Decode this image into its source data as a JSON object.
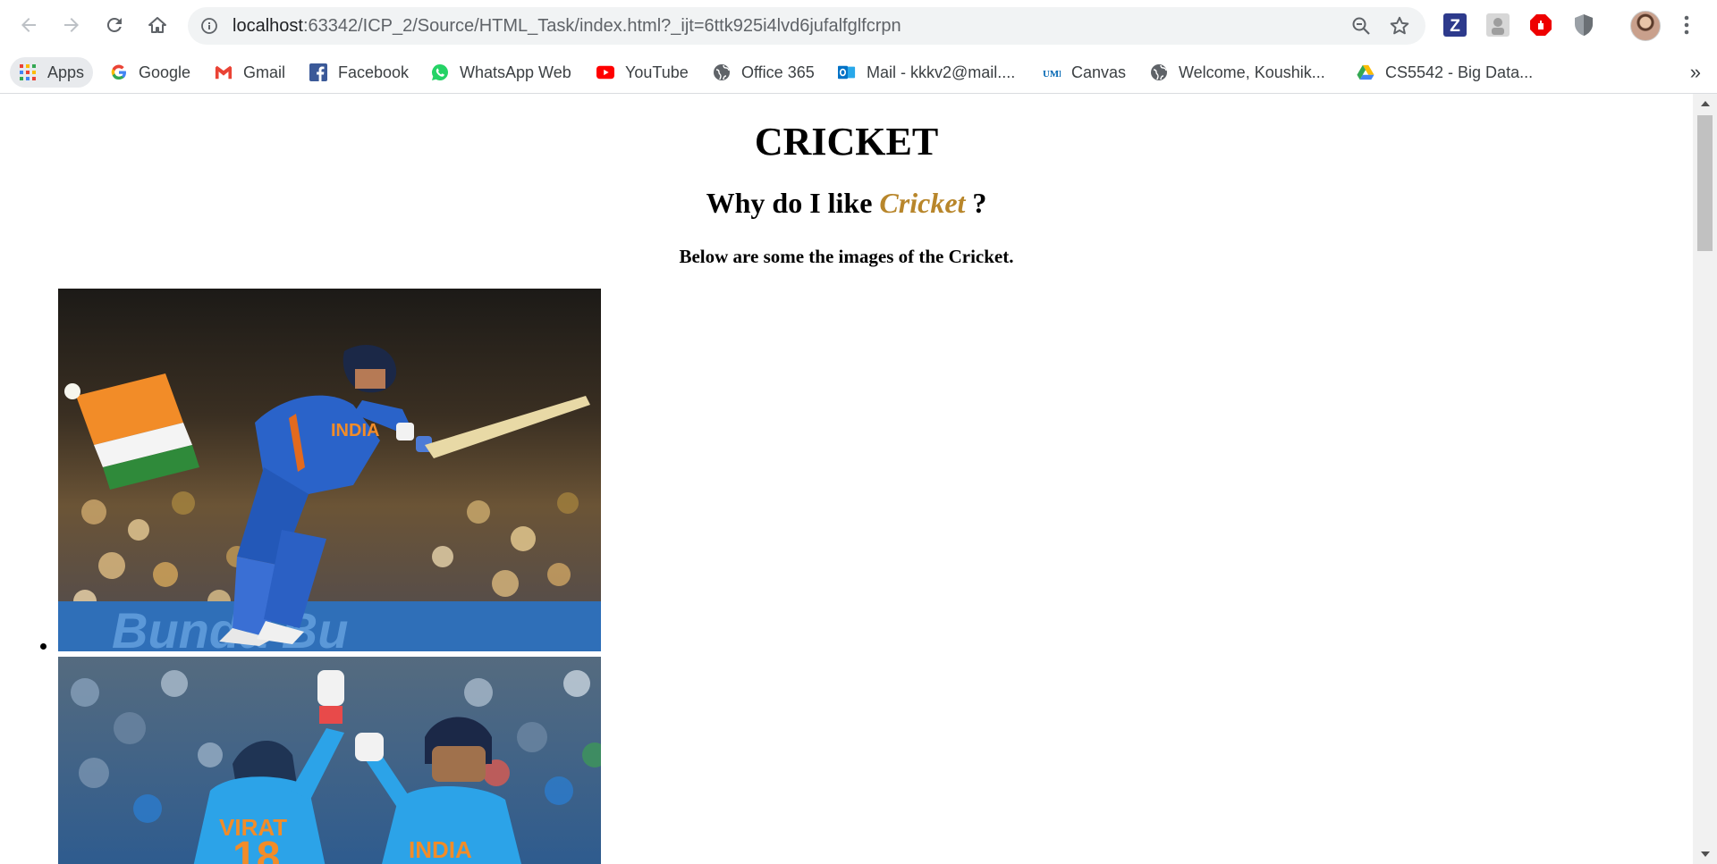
{
  "browser": {
    "url_host": "localhost",
    "url_rest": ":63342/ICP_2/Source/HTML_Task/index.html?_ijt=6ttk925i4lvd6jufalfglfcrpn",
    "bookmarks": [
      {
        "label": "Apps",
        "icon": "apps-grid-icon"
      },
      {
        "label": "Google",
        "icon": "google-icon"
      },
      {
        "label": "Gmail",
        "icon": "gmail-icon"
      },
      {
        "label": "Facebook",
        "icon": "facebook-icon"
      },
      {
        "label": "WhatsApp Web",
        "icon": "whatsapp-icon"
      },
      {
        "label": "YouTube",
        "icon": "youtube-icon"
      },
      {
        "label": "Office 365",
        "icon": "globe-icon"
      },
      {
        "label": "Mail - kkkv2@mail....",
        "icon": "outlook-icon"
      },
      {
        "label": "Canvas",
        "icon": "umkc-icon"
      },
      {
        "label": "Welcome, Koushik...",
        "icon": "globe-icon"
      },
      {
        "label": "CS5542 - Big Data...",
        "icon": "drive-icon"
      }
    ],
    "more_label": "»",
    "colors": {
      "accent_orange": "#b8862b",
      "youtube_red": "#ff0000",
      "facebook_blue": "#3b5998",
      "whatsapp_green": "#25d366"
    }
  },
  "page": {
    "title": "CRICKET",
    "subtitle_prefix": "Why do I like ",
    "subtitle_emph": "Cricket",
    "subtitle_suffix": " ?",
    "lead": "Below are some the images of the Cricket."
  },
  "images": [
    {
      "name": "cricket-batsman-photo"
    },
    {
      "name": "cricket-celebration-photo"
    }
  ]
}
